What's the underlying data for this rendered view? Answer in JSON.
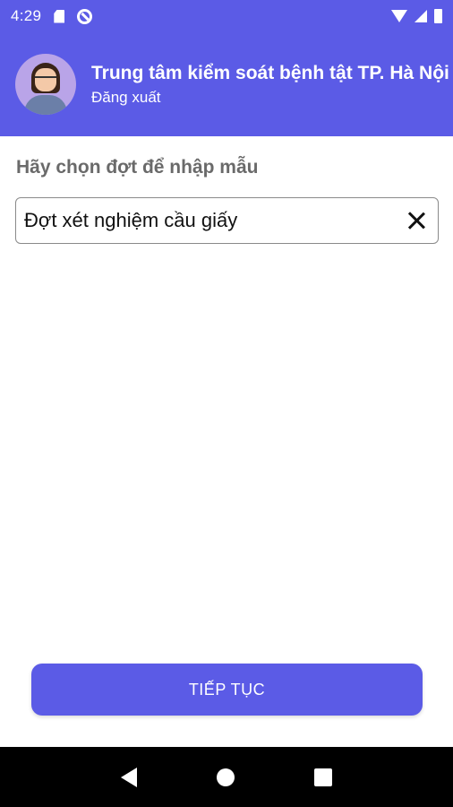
{
  "status_bar": {
    "time": "4:29",
    "icons": [
      "sd-card-icon",
      "sync-icon",
      "wifi-icon",
      "signal-icon",
      "battery-icon"
    ]
  },
  "header": {
    "title": "Trung tâm kiểm soát bệnh tật TP. Hà Nội",
    "logout_label": "Đăng xuất"
  },
  "main": {
    "prompt": "Hãy chọn đợt để nhập mẫu",
    "selected_batch": "Đợt xét nghiệm cầu giấy"
  },
  "actions": {
    "continue_label": "TIẾP TỤC"
  },
  "colors": {
    "primary": "#5b5be6",
    "prompt_text": "#6a6a6a"
  }
}
